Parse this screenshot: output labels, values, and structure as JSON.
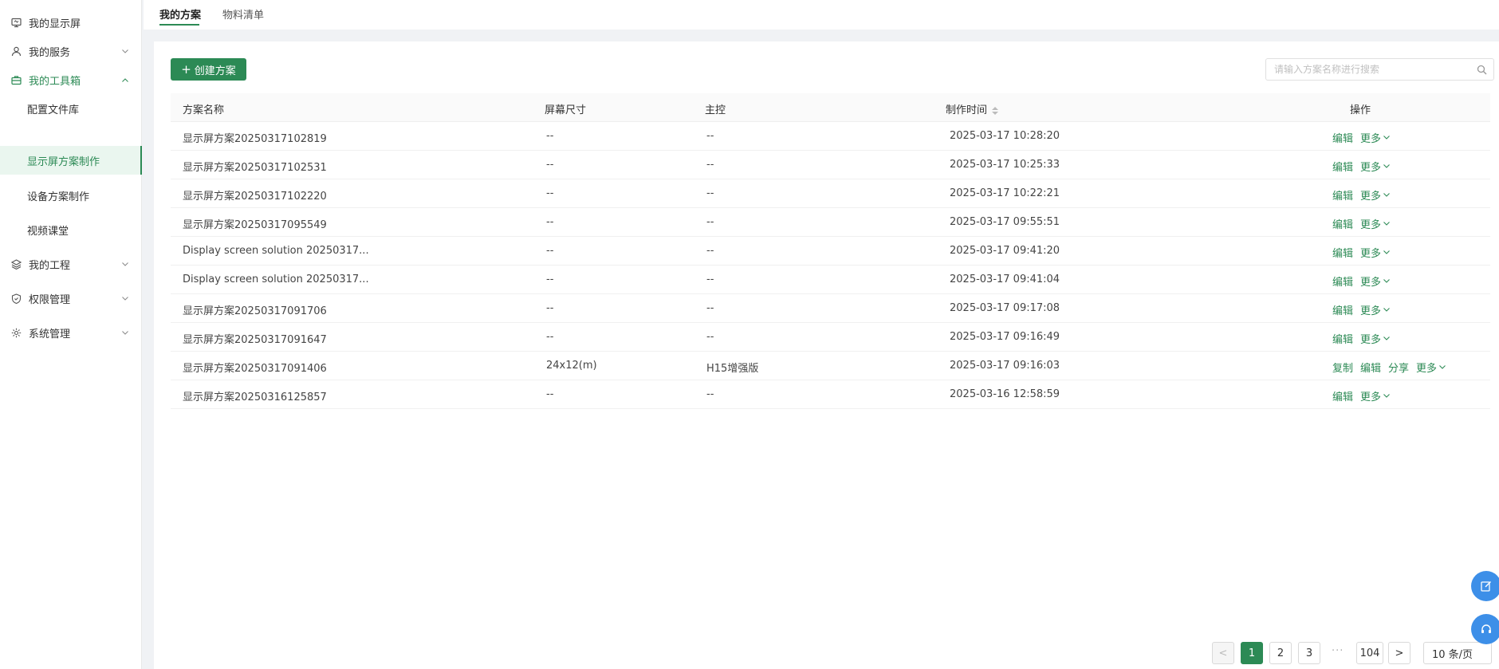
{
  "sidebar": {
    "items": [
      {
        "label": "我的显示屏",
        "icon": "monitor-icon"
      },
      {
        "label": "我的服务",
        "icon": "user-icon"
      },
      {
        "label": "我的工具箱",
        "icon": "toolbox-icon"
      },
      {
        "label": "配置文件库"
      },
      {
        "label": "显示屏方案制作"
      },
      {
        "label": "设备方案制作"
      },
      {
        "label": "视频课堂"
      },
      {
        "label": "我的工程",
        "icon": "layers-icon"
      },
      {
        "label": "权限管理",
        "icon": "shield-icon"
      },
      {
        "label": "系统管理",
        "icon": "gear-icon"
      }
    ]
  },
  "tabs": [
    {
      "label": "我的方案"
    },
    {
      "label": "物料清单"
    }
  ],
  "toolbar": {
    "create_label": "创建方案",
    "search_placeholder": "请输入方案名称进行搜索"
  },
  "table": {
    "columns": [
      "方案名称",
      "屏幕尺寸",
      "主控",
      "制作时间",
      "操作"
    ],
    "rows": [
      {
        "name": "显示屏方案20250317102819",
        "size": "--",
        "controller": "--",
        "time": "2025-03-17 10:28:20",
        "actions": [
          "编辑"
        ]
      },
      {
        "name": "显示屏方案20250317102531",
        "size": "--",
        "controller": "--",
        "time": "2025-03-17 10:25:33",
        "actions": [
          "编辑"
        ]
      },
      {
        "name": "显示屏方案20250317102220",
        "size": "--",
        "controller": "--",
        "time": "2025-03-17 10:22:21",
        "actions": [
          "编辑"
        ]
      },
      {
        "name": "显示屏方案20250317095549",
        "size": "--",
        "controller": "--",
        "time": "2025-03-17 09:55:51",
        "actions": [
          "编辑"
        ]
      },
      {
        "name": "Display screen solution 20250317...",
        "size": "--",
        "controller": "--",
        "time": "2025-03-17 09:41:20",
        "actions": [
          "编辑"
        ]
      },
      {
        "name": "Display screen solution 20250317...",
        "size": "--",
        "controller": "--",
        "time": "2025-03-17 09:41:04",
        "actions": [
          "编辑"
        ]
      },
      {
        "name": "显示屏方案20250317091706",
        "size": "--",
        "controller": "--",
        "time": "2025-03-17 09:17:08",
        "actions": [
          "编辑"
        ]
      },
      {
        "name": "显示屏方案20250317091647",
        "size": "--",
        "controller": "--",
        "time": "2025-03-17 09:16:49",
        "actions": [
          "编辑"
        ]
      },
      {
        "name": "显示屏方案20250317091406",
        "size": "24x12(m)",
        "controller": "H15增强版",
        "time": "2025-03-17 09:16:03",
        "actions": [
          "复制",
          "编辑",
          "分享"
        ]
      },
      {
        "name": "显示屏方案20250316125857",
        "size": "--",
        "controller": "--",
        "time": "2025-03-16 12:58:59",
        "actions": [
          "编辑"
        ]
      }
    ],
    "more_label": "更多"
  },
  "pagination": {
    "prev": "<",
    "next": ">",
    "pages": [
      "1",
      "2",
      "3"
    ],
    "current": "1",
    "ellipsis": "···",
    "last": "104",
    "page_size": "10 条/页"
  },
  "colors": {
    "accent": "#2c8a55",
    "fab": "#3d8fe8"
  }
}
